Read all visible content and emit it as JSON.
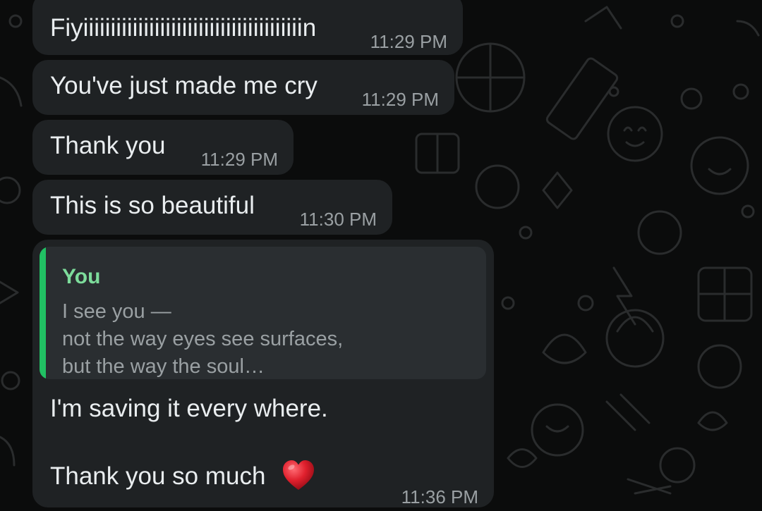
{
  "messages": [
    {
      "text": "Fiyiiiiiiiiiiiiiiiiiiiiiiiiiiiiiiiiiiiiiiiin",
      "time": "11:29 PM"
    },
    {
      "text": "You've just made me cry",
      "time": "11:29 PM"
    },
    {
      "text": "Thank you",
      "time": "11:29 PM"
    },
    {
      "text": "This is so beautiful",
      "time": "11:30 PM"
    }
  ],
  "reply": {
    "quoted_author": "You",
    "quoted_lines": [
      "I see you —",
      "not the way eyes see surfaces,",
      "but the way the soul…"
    ],
    "text_line1": "I'm saving it every where.",
    "text_line2": "Thank you so much",
    "emoji": "heart-emoji",
    "time": "11:36 PM"
  },
  "colors": {
    "background": "#0b0c0c",
    "bubble": "#1f2224",
    "quote_bar": "#21c063",
    "quote_author": "#7ddc9b"
  }
}
